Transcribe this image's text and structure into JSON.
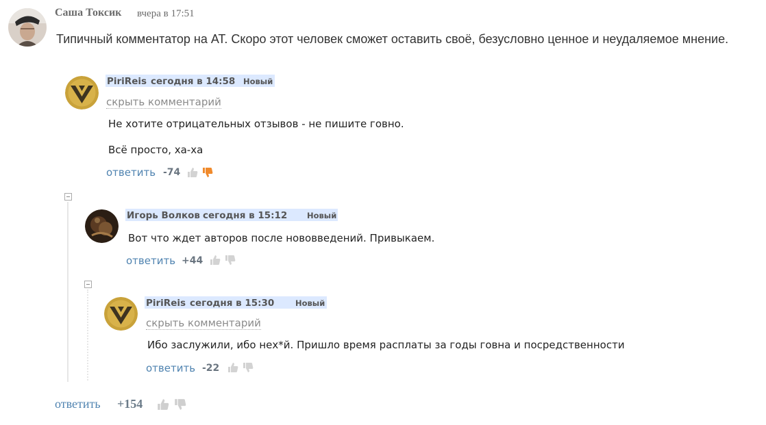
{
  "top_comment": {
    "author": "Саша Токсик",
    "time": "вчера в 17:51",
    "text": "Типичный комментатор на АТ. Скоро этот человек сможет оставить своё, безусловно ценное и неудаляемое мнение.",
    "reply_label": "ответить",
    "score": "+154"
  },
  "replies": [
    {
      "author": "PiriReis",
      "time": "сегодня в 14:58",
      "badge": "Новый",
      "hide_label": "скрыть комментарий",
      "text_lines": [
        "Не хотите отрицательных отзывов - не пишите говно.",
        "Всё просто, ха-ха"
      ],
      "reply_label": "ответить",
      "score": "-74",
      "vote": "down"
    },
    {
      "author": "Игорь Волков",
      "time": "сегодня в 15:12",
      "badge": "Новый",
      "text_lines": [
        "Вот что ждет авторов после нововведений. Привыкаем."
      ],
      "reply_label": "ответить",
      "score": "+44",
      "vote": "none"
    },
    {
      "author": "PiriReis",
      "time": "сегодня в 15:30",
      "badge": "Новый",
      "hide_label": "скрыть комментарий",
      "text_lines": [
        "Ибо заслужили, ибо нех*й. Пришло время расплаты за годы говна и посредственности"
      ],
      "reply_label": "ответить",
      "score": "-22",
      "vote": "none"
    }
  ],
  "colors": {
    "link": "#4f83b0",
    "highlight": "#dce9ff",
    "downvote_active": "#f08a2c"
  },
  "icons": [
    "thumbs-up-icon",
    "thumbs-down-icon",
    "collapse-icon",
    "avatar-image"
  ]
}
